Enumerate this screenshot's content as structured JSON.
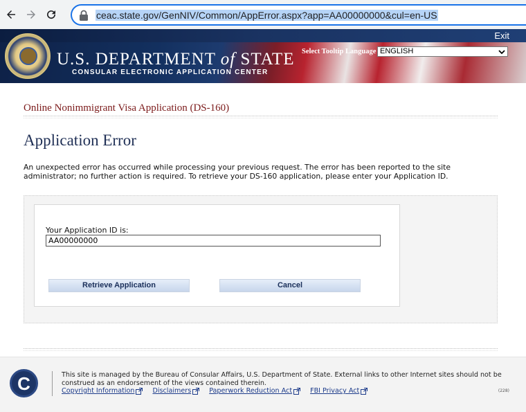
{
  "browser": {
    "url": "ceac.state.gov/GenNIV/Common/AppError.aspx?app=AA00000000&cul=en-US"
  },
  "header": {
    "exit_label": "Exit",
    "dept_title_pre": "U.S. DEPARTMENT ",
    "dept_title_of": "of",
    "dept_title_post": " STATE",
    "dept_subtitle": "CONSULAR ELECTRONIC APPLICATION CENTER",
    "tooltip_label": "Select Tooltip Language",
    "language_selected": "ENGLISH"
  },
  "main": {
    "app_title": "Online Nonimmigrant Visa Application (DS-160)",
    "page_title": "Application Error",
    "error_message": "An unexpected error has occurred while processing your previous request. The error has been reported to the site administrator; no further action is required. To retrieve your DS-160 application, please enter your Application ID.",
    "id_label": "Your Application ID is:",
    "id_value": "AA00000000",
    "retrieve_label": "Retrieve Application",
    "cancel_label": "Cancel"
  },
  "footer": {
    "logo_letter": "C",
    "text": "This site is managed by the Bureau of Consular Affairs, U.S. Department of State. External links to other Internet sites should not be construed as an endorsement of the views contained therein.",
    "links": [
      "Copyright Information",
      "Disclaimers",
      "Paperwork Reduction Act",
      "FBI Privacy Act"
    ],
    "version": "(228)"
  }
}
